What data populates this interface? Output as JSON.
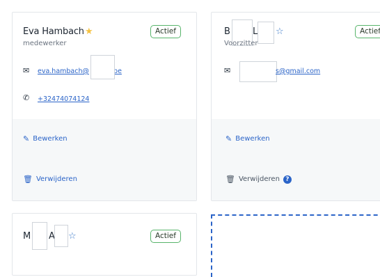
{
  "cards": [
    {
      "name": "Eva Hambach",
      "role": "medewerker",
      "status": "Actief",
      "email": "eva.hambach@",
      "email_suffix": ".be",
      "phone": "+32474074124",
      "edit_label": "Bewerken",
      "delete_label": "Verwijderen",
      "favorite": true
    },
    {
      "name_part1": "B",
      "name_part2": "L",
      "role": "Voorzitter",
      "status": "Actief",
      "email_suffix": "s@gmail.com",
      "edit_label": "Bewerken",
      "delete_label": "Verwijderen",
      "favorite": false
    },
    {
      "name_part1": "M",
      "name_part2": "A",
      "status": "Actief",
      "favorite": false
    }
  ],
  "icons": {
    "star_filled": "star-filled-icon",
    "star_outline": "star-outline-icon",
    "mail": "mail-icon",
    "phone": "phone-icon",
    "pencil": "pencil-icon",
    "trash": "trash-icon",
    "help": "help-icon"
  },
  "colors": {
    "accent": "#2b64c8",
    "badge_border": "#57b46a",
    "star": "#f5c242",
    "action_bg": "#f6f8f9"
  }
}
